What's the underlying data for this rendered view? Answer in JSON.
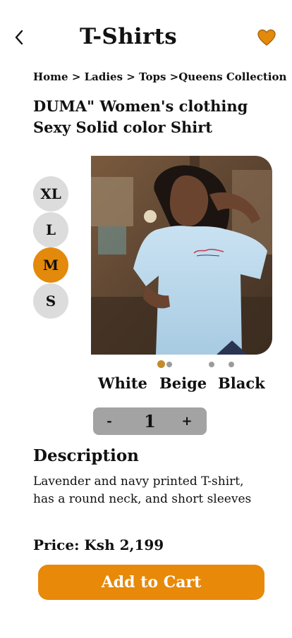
{
  "header": {
    "title": "T-Shirts",
    "back_icon": "chevron-left-icon",
    "favorite_icon": "heart-icon",
    "favorite_color": "#e3890b"
  },
  "breadcrumb": "Home > Ladies > Tops >Queens Collection",
  "product": {
    "name": "DUMA\" Women's clothing Sexy Solid color Shirt",
    "image": "woman-in-light-blue-tshirt-photo"
  },
  "sizes": [
    {
      "label": "XL",
      "selected": false
    },
    {
      "label": "L",
      "selected": false
    },
    {
      "label": "M",
      "selected": true
    },
    {
      "label": "S",
      "selected": false
    }
  ],
  "carousel": {
    "count": 4,
    "active_index": 0
  },
  "colors": [
    "White",
    "Beige",
    "Black"
  ],
  "quantity": {
    "minus": "-",
    "value": "1",
    "plus": "+"
  },
  "description": {
    "heading": "Description",
    "text": "Lavender and navy printed T-shirt, has a round neck, and short sleeves"
  },
  "price": "Price: Ksh 2,199",
  "add_to_cart": "Add to Cart",
  "accent_color": "#e8890a"
}
